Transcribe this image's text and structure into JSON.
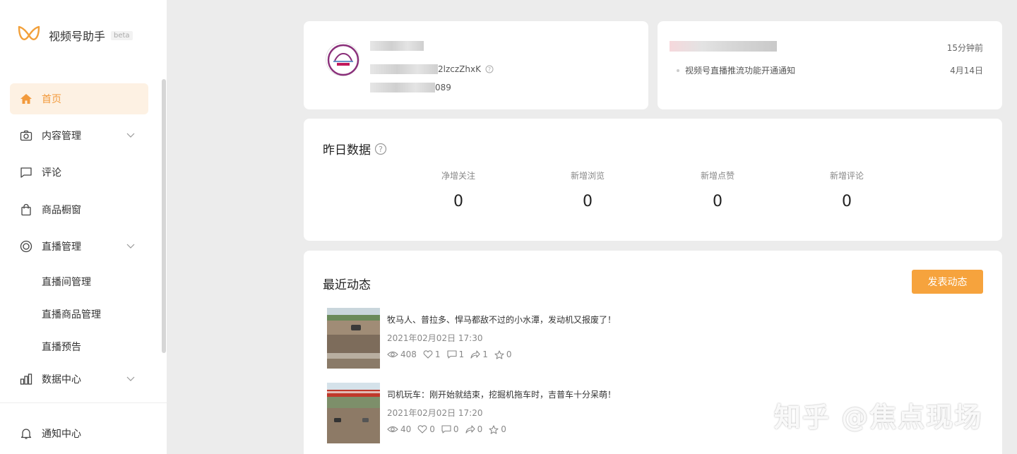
{
  "app": {
    "name": "视频号助手",
    "badge": "beta"
  },
  "sidebar": {
    "items": [
      {
        "label": "首页",
        "icon": "home-icon"
      },
      {
        "label": "内容管理",
        "icon": "camera-icon"
      },
      {
        "label": "评论",
        "icon": "comment-icon"
      },
      {
        "label": "商品橱窗",
        "icon": "shopping-bag-icon"
      },
      {
        "label": "直播管理",
        "icon": "live-icon"
      },
      {
        "label": "直播间管理"
      },
      {
        "label": "直播商品管理"
      },
      {
        "label": "直播预告"
      },
      {
        "label": "数据中心",
        "icon": "bar-chart-icon"
      },
      {
        "label": "通知中心",
        "icon": "bell-icon"
      }
    ]
  },
  "profile": {
    "id_partial": "2lzczZhxK",
    "number_partial": "089"
  },
  "notifications": {
    "time": "15分钟前",
    "item_text": "视频号直播推流功能开通通知",
    "item_date": "4月14日"
  },
  "yesterday": {
    "title": "昨日数据",
    "stats": [
      {
        "label": "净增关注",
        "value": "0"
      },
      {
        "label": "新增浏览",
        "value": "0"
      },
      {
        "label": "新增点赞",
        "value": "0"
      },
      {
        "label": "新增评论",
        "value": "0"
      }
    ]
  },
  "recent": {
    "title": "最近动态",
    "publish_label": "发表动态",
    "posts": [
      {
        "title": "牧马人、普拉多、悍马都敌不过的小水潭，发动机又报废了！",
        "time": "2021年02月02日 17:30",
        "views": "408",
        "likes": "1",
        "comments": "1",
        "shares": "1",
        "stars": "0"
      },
      {
        "title": "司机玩车：刚开始就结束，挖掘机拖车时，吉普车十分呆萌！",
        "time": "2021年02月02日 17:20",
        "views": "40",
        "likes": "0",
        "comments": "0",
        "shares": "0",
        "stars": "0"
      }
    ]
  },
  "watermark": "知乎 @焦点现场",
  "colors": {
    "accent": "#f6a33d",
    "active_bg": "#fdf1e3"
  }
}
